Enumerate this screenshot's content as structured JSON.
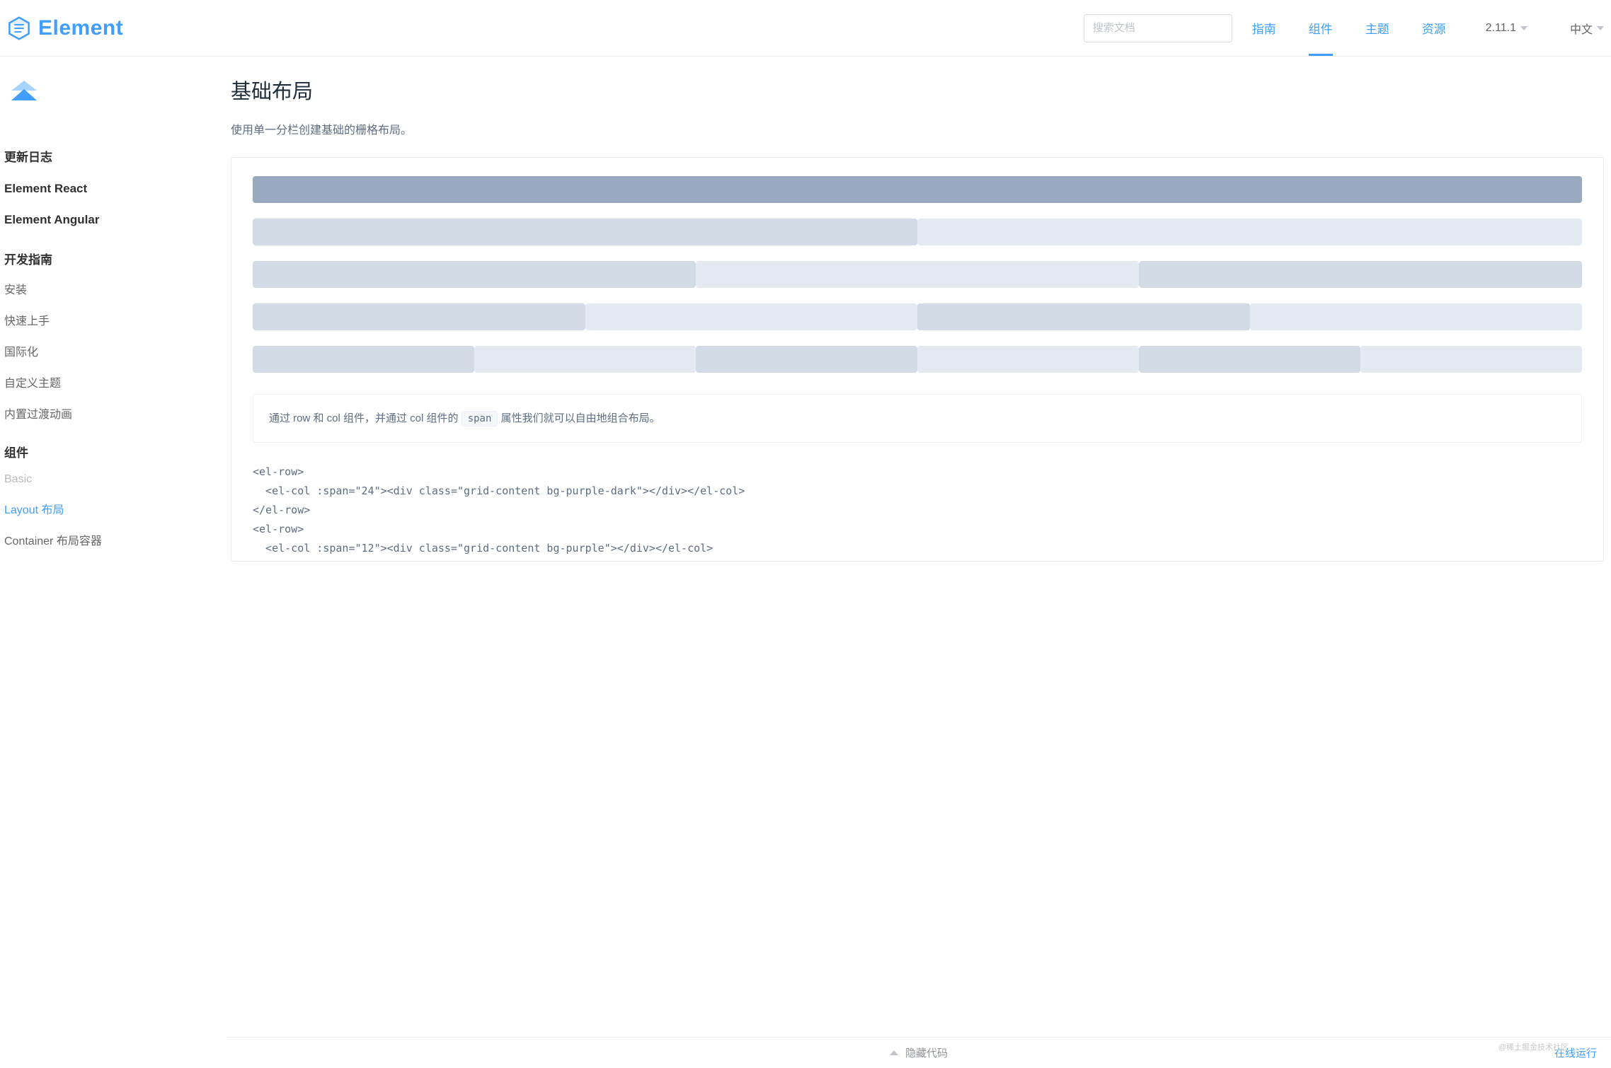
{
  "brand": "Element",
  "search": {
    "placeholder": "搜索文档"
  },
  "nav": {
    "guide": "指南",
    "component": "组件",
    "theme": "主题",
    "resource": "资源"
  },
  "version": "2.11.1",
  "language": "中文",
  "sidebar": {
    "items": [
      {
        "label": "更新日志",
        "bold": true
      },
      {
        "label": "Element React",
        "bold": true
      },
      {
        "label": "Element Angular",
        "bold": true
      }
    ],
    "dev_guide_title": "开发指南",
    "dev_guide": [
      {
        "label": "安装"
      },
      {
        "label": "快速上手"
      },
      {
        "label": "国际化"
      },
      {
        "label": "自定义主题"
      },
      {
        "label": "内置过渡动画"
      }
    ],
    "components_title": "组件",
    "components": [
      {
        "label": "Basic",
        "muted": true
      },
      {
        "label": "Layout 布局",
        "active": true
      },
      {
        "label": "Container 布局容器"
      }
    ]
  },
  "page": {
    "title": "基础布局",
    "desc": "使用单一分栏创建基础的栅格布局。",
    "explain_pre": "通过 row 和 col 组件，并通过 col 组件的 ",
    "explain_code": "span",
    "explain_post": " 属性我们就可以自由地组合布局。",
    "code": "<el-row>\n  <el-col :span=\"24\"><div class=\"grid-content bg-purple-dark\"></div></el-col>\n</el-row>\n<el-row>\n  <el-col :span=\"12\"><div class=\"grid-content bg-purple\"></div></el-col>"
  },
  "bottom": {
    "hide_code": "隐藏代码",
    "run_online": "在线运行"
  },
  "watermark": "@稀土掘金技术社区"
}
